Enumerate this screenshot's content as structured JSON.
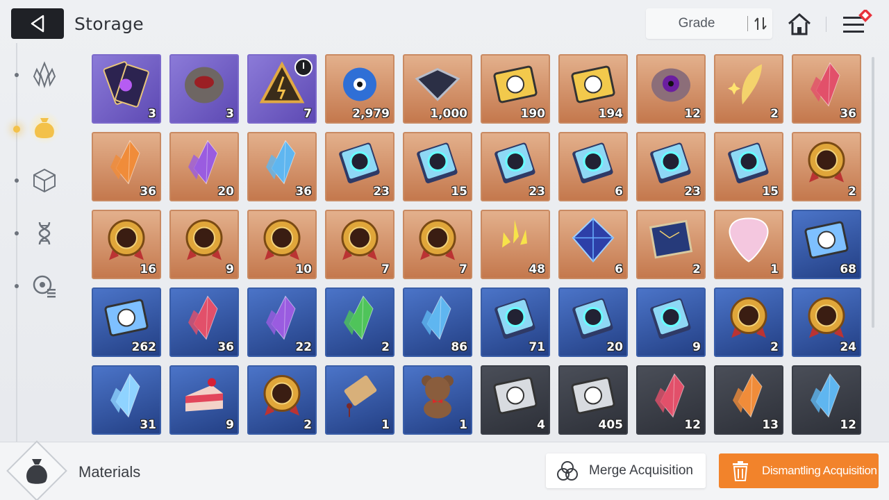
{
  "header": {
    "title": "Storage",
    "sort_label": "Grade"
  },
  "sidebar": {
    "items": [
      {
        "icon": "crystal-cluster-icon",
        "active": false
      },
      {
        "icon": "pouch-icon",
        "active": true
      },
      {
        "icon": "cube-icon",
        "active": false
      },
      {
        "icon": "dna-icon",
        "active": false
      },
      {
        "icon": "badge-list-icon",
        "active": false
      }
    ]
  },
  "items": [
    {
      "rarity": "purple",
      "icon": "card-pack-icon",
      "count": "3"
    },
    {
      "rarity": "purple",
      "icon": "stone-core-icon",
      "count": "3"
    },
    {
      "rarity": "purple",
      "icon": "triangle-device-icon",
      "count": "7",
      "timer": true
    },
    {
      "rarity": "orange",
      "icon": "tentacle-eye-icon",
      "count": "2,979"
    },
    {
      "rarity": "orange",
      "icon": "chip-icon",
      "count": "1,000"
    },
    {
      "rarity": "orange",
      "icon": "gold-ticket-icon",
      "count": "190"
    },
    {
      "rarity": "orange",
      "icon": "gold-star-ticket-icon",
      "count": "194"
    },
    {
      "rarity": "orange",
      "icon": "purple-eye-core-icon",
      "count": "12"
    },
    {
      "rarity": "orange",
      "icon": "golden-feather-icon",
      "count": "2"
    },
    {
      "rarity": "orange",
      "icon": "red-crystal-icon",
      "count": "36"
    },
    {
      "rarity": "orange",
      "icon": "orange-crystal-icon",
      "count": "36"
    },
    {
      "rarity": "orange",
      "icon": "purple-crystal-icon",
      "count": "20"
    },
    {
      "rarity": "orange",
      "icon": "blue-crystal-icon",
      "count": "36"
    },
    {
      "rarity": "orange",
      "icon": "sword-manual-icon",
      "count": "23"
    },
    {
      "rarity": "orange",
      "icon": "shield-manual-icon",
      "count": "15"
    },
    {
      "rarity": "orange",
      "icon": "eye-manual-icon",
      "count": "23"
    },
    {
      "rarity": "orange",
      "icon": "wing-manual-icon",
      "count": "6"
    },
    {
      "rarity": "orange",
      "icon": "bolt-manual-icon",
      "count": "23"
    },
    {
      "rarity": "orange",
      "icon": "target-manual-icon",
      "count": "15"
    },
    {
      "rarity": "orange",
      "icon": "sword-medal-icon",
      "count": "2"
    },
    {
      "rarity": "orange",
      "icon": "shield-medal-icon",
      "count": "16"
    },
    {
      "rarity": "orange",
      "icon": "eye-medal-icon",
      "count": "9"
    },
    {
      "rarity": "orange",
      "icon": "wing-medal-icon",
      "count": "10"
    },
    {
      "rarity": "orange",
      "icon": "bolt-medal-icon",
      "count": "7"
    },
    {
      "rarity": "orange",
      "icon": "target-medal-icon",
      "count": "7"
    },
    {
      "rarity": "orange",
      "icon": "yellow-shards-icon",
      "count": "48"
    },
    {
      "rarity": "orange",
      "icon": "blue-octahedron-icon",
      "count": "6"
    },
    {
      "rarity": "orange",
      "icon": "star-map-book-icon",
      "count": "2"
    },
    {
      "rarity": "orange",
      "icon": "iridescent-pick-icon",
      "count": "1"
    },
    {
      "rarity": "blue",
      "icon": "blue-ticket-icon",
      "count": "68"
    },
    {
      "rarity": "blue",
      "icon": "blue-star-ticket-icon",
      "count": "262"
    },
    {
      "rarity": "blue",
      "icon": "red-crystal-icon",
      "count": "36"
    },
    {
      "rarity": "blue",
      "icon": "purple-crystal-icon",
      "count": "22"
    },
    {
      "rarity": "blue",
      "icon": "green-crystal-icon",
      "count": "2"
    },
    {
      "rarity": "blue",
      "icon": "blue-crystal-icon",
      "count": "86"
    },
    {
      "rarity": "blue",
      "icon": "sword-manual-icon",
      "count": "71"
    },
    {
      "rarity": "blue",
      "icon": "shield-manual-icon",
      "count": "20"
    },
    {
      "rarity": "blue",
      "icon": "bolt-manual-icon",
      "count": "9"
    },
    {
      "rarity": "blue",
      "icon": "eye-medal-icon",
      "count": "2"
    },
    {
      "rarity": "blue",
      "icon": "bolt-medal-icon",
      "count": "24"
    },
    {
      "rarity": "blue",
      "icon": "ice-crystal-icon",
      "count": "31"
    },
    {
      "rarity": "blue",
      "icon": "cake-slice-icon",
      "count": "9"
    },
    {
      "rarity": "blue",
      "icon": "red-star-medal-icon",
      "count": "2"
    },
    {
      "rarity": "blue",
      "icon": "tag-icon",
      "count": "1"
    },
    {
      "rarity": "blue",
      "icon": "teddy-bear-icon",
      "count": "1"
    },
    {
      "rarity": "gray",
      "icon": "silver-ticket-icon",
      "count": "4"
    },
    {
      "rarity": "gray",
      "icon": "silver-star-ticket-icon",
      "count": "405"
    },
    {
      "rarity": "gray",
      "icon": "red-crystal-icon",
      "count": "12"
    },
    {
      "rarity": "gray",
      "icon": "orange-crystal-icon",
      "count": "13"
    },
    {
      "rarity": "gray",
      "icon": "blue-crystal-icon",
      "count": "12"
    }
  ],
  "footer": {
    "category_label": "Materials",
    "merge_label": "Merge Acquisition",
    "dismantle_label": "Dismantling Acquisition"
  },
  "colors": {
    "accent_orange": "#f2832b",
    "purple": "#6b57c2",
    "orange": "#d08f67",
    "blue": "#3a5ea8",
    "gray": "#3a3e47"
  }
}
